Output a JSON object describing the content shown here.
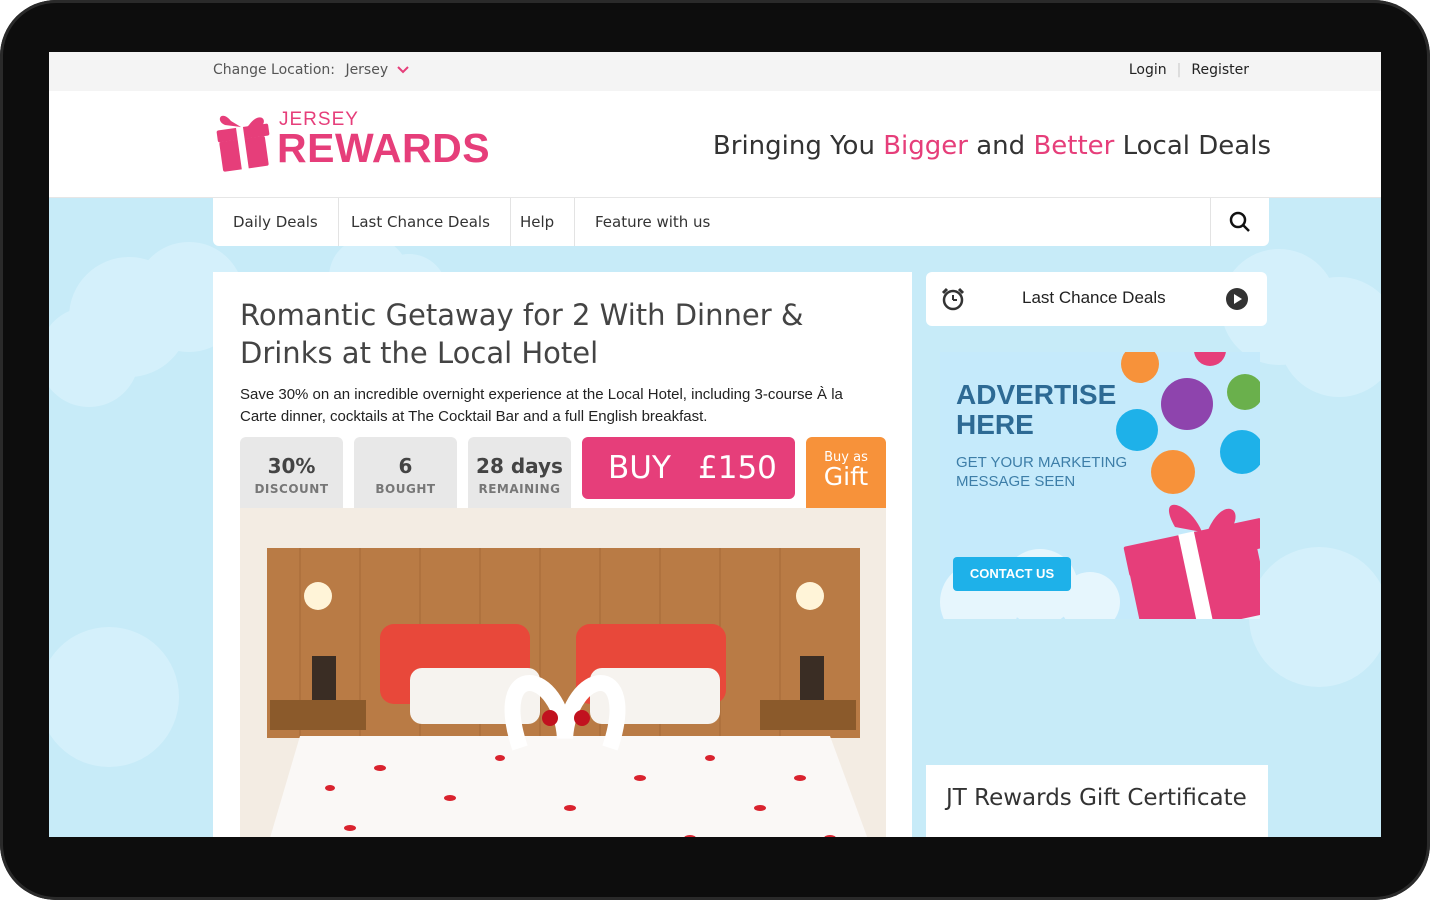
{
  "topbar": {
    "change_location_label": "Change Location:",
    "location": "Jersey",
    "login": "Login",
    "register": "Register"
  },
  "header": {
    "logo_top": "JERSEY",
    "logo_main": "REWARDS",
    "tagline_1": "Bringing You ",
    "tagline_bigger": "Bigger",
    "tagline_2": " and ",
    "tagline_better": "Better",
    "tagline_3": " Local Deals"
  },
  "nav": {
    "items": [
      "Daily Deals",
      "Last Chance Deals",
      "Help",
      "Feature with us"
    ],
    "search_icon": "search-icon"
  },
  "deal": {
    "title": "Romantic Getaway for 2 With Dinner & Drinks at the Local Hotel",
    "description": "Save 30% on an incredible overnight experience at the Local Hotel, including 3-course À la Carte dinner, cocktails at The Cocktail Bar and a full English breakfast.",
    "stats": [
      {
        "value": "30%",
        "label": "DISCOUNT"
      },
      {
        "value": "6",
        "label": "BOUGHT"
      },
      {
        "value": "28 days",
        "label": "REMAINING"
      }
    ],
    "buy_label": "BUY",
    "price": "£150",
    "gift_small": "Buy as",
    "gift_big": "Gift"
  },
  "sidebar": {
    "last_chance_title": "Last Chance Deals",
    "ad_heading_1": "ADVERTISE",
    "ad_heading_2": "HERE",
    "ad_sub_1": "GET YOUR MARKETING",
    "ad_sub_2": "MESSAGE SEEN",
    "ad_cta": "CONTACT US",
    "certificate_title": "JT Rewards Gift Certificate"
  },
  "colors": {
    "brand_pink": "#e63e7a",
    "gift_orange": "#f7923a",
    "sky": "#c7ebf8",
    "cta_blue": "#1eb1e9"
  }
}
